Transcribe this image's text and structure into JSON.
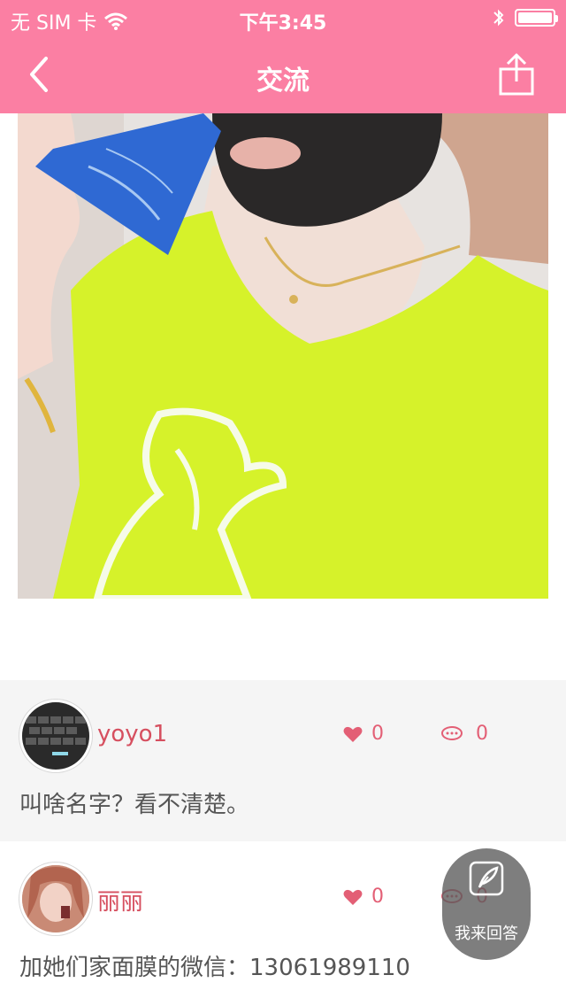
{
  "status": {
    "carrier": "无 SIM 卡",
    "time": "下午3:45"
  },
  "nav": {
    "title": "交流"
  },
  "comments": [
    {
      "username": "yoyo1",
      "likes": "0",
      "replies": "0",
      "text": "叫啥名字？看不清楚。"
    },
    {
      "username": "丽丽",
      "likes": "0",
      "replies": "0",
      "text": "加她们家面膜的微信：13061989110"
    }
  ],
  "fab": {
    "label": "我来回答"
  },
  "colors": {
    "accent": "#fb7fa3",
    "username": "#d64f5f",
    "icon": "#e35f75"
  }
}
